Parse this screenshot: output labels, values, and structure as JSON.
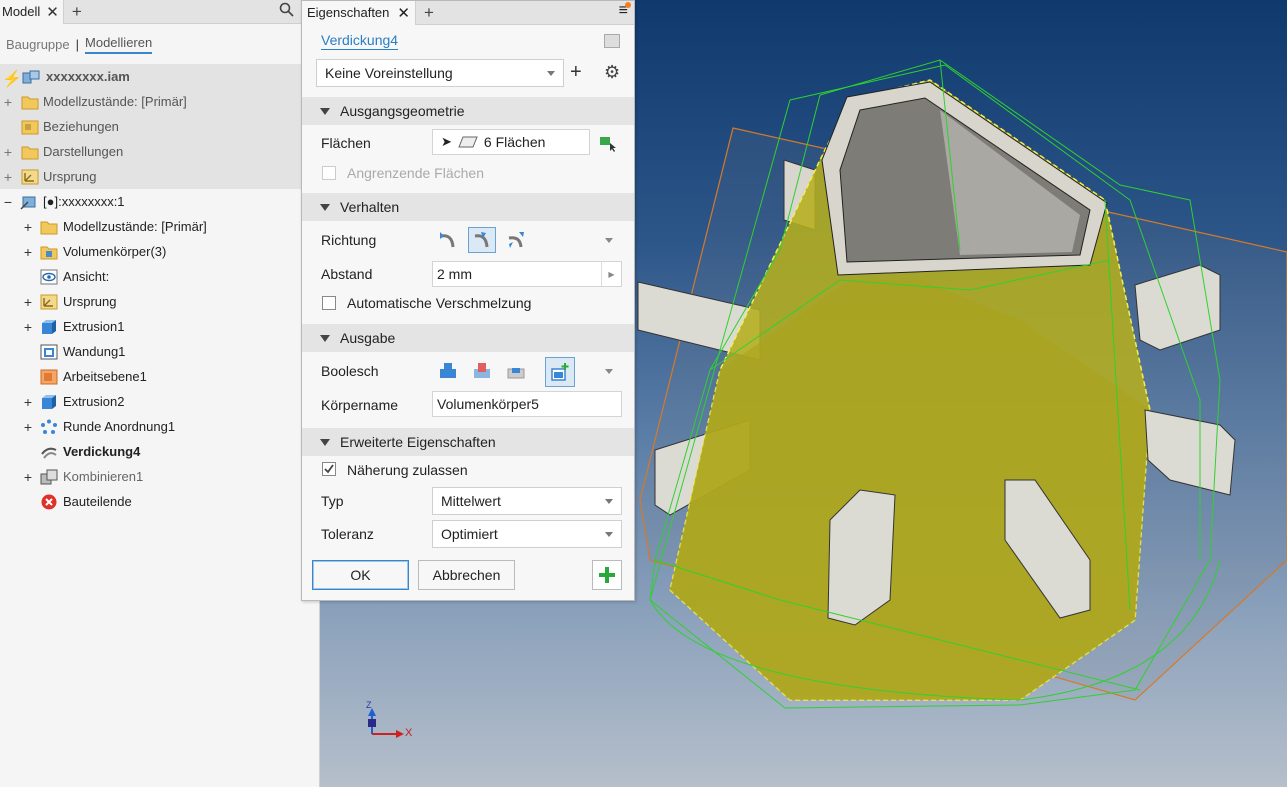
{
  "browser": {
    "tab_label": "Modell",
    "subtabs": [
      "Baugruppe",
      "Modellieren"
    ],
    "tree": [
      {
        "label": "xxxxxxxx.iam"
      },
      {
        "label": "Modellzustände: [Primär]"
      },
      {
        "label": "Beziehungen"
      },
      {
        "label": "Darstellungen"
      },
      {
        "label": "Ursprung"
      },
      {
        "label": "[●]:xxxxxxxx:1"
      },
      {
        "label": "Modellzustände: [Primär]"
      },
      {
        "label": "Volumenkörper(3)"
      },
      {
        "label": "Ansicht:"
      },
      {
        "label": "Ursprung"
      },
      {
        "label": "Extrusion1"
      },
      {
        "label": "Wandung1"
      },
      {
        "label": "Arbeitsebene1"
      },
      {
        "label": "Extrusion2"
      },
      {
        "label": "Runde Anordnung1"
      },
      {
        "label": "Verdickung4"
      },
      {
        "label": "Kombinieren1"
      },
      {
        "label": "Bauteilende"
      }
    ]
  },
  "props": {
    "tab_label": "Eigenschaften",
    "feature_name": "Verdickung4",
    "preset": "Keine Voreinstellung",
    "sections": {
      "input_geometry": "Ausgangsgeometrie",
      "behavior": "Verhalten",
      "output": "Ausgabe",
      "advanced": "Erweiterte Eigenschaften"
    },
    "faces_label": "Flächen",
    "faces_value": "6 Flächen",
    "adjacent_faces": "Angrenzende Flächen",
    "direction_label": "Richtung",
    "distance_label": "Abstand",
    "distance_value": "2 mm",
    "auto_blend": "Automatische Verschmelzung",
    "boolean_label": "Boolesch",
    "body_name_label": "Körpername",
    "body_name_value": "Volumenkörper5",
    "approx_label": "Näherung zulassen",
    "approx_checked": true,
    "type_label": "Typ",
    "type_value": "Mittelwert",
    "tolerance_label": "Toleranz",
    "tolerance_value": "Optimiert",
    "ok": "OK",
    "cancel": "Abbrechen"
  },
  "viewcube": {
    "z": "Z",
    "x": "X"
  }
}
